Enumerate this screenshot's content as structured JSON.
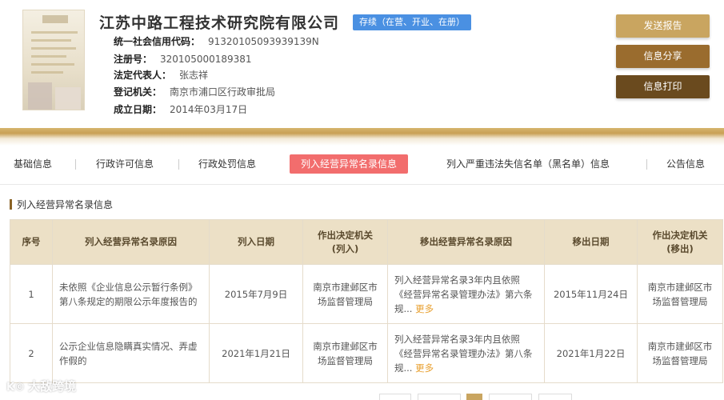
{
  "company": {
    "name": "江苏中路工程技术研究院有限公司",
    "status": "存续（在营、开业、在册）",
    "fields": [
      {
        "label": "统一社会信用代码：",
        "value": "91320105093939139N"
      },
      {
        "label": "注册号：",
        "value": "320105000189381"
      },
      {
        "label": "法定代表人：",
        "value": "张志祥"
      },
      {
        "label": "登记机关：",
        "value": "南京市浦口区行政审批局"
      },
      {
        "label": "成立日期：",
        "value": "2014年03月17日"
      }
    ]
  },
  "actions": {
    "send_report": "发送报告",
    "share": "信息分享",
    "print": "信息打印"
  },
  "tabs": [
    {
      "label": "基础信息"
    },
    {
      "label": "行政许可信息"
    },
    {
      "label": "行政处罚信息"
    },
    {
      "label": "列入经营异常名录信息"
    },
    {
      "label": "列入严重违法失信名单（黑名单）信息"
    },
    {
      "label": "公告信息"
    }
  ],
  "active_tab": "列入经营异常名录信息",
  "section": {
    "title": "列入经营异常名录信息"
  },
  "table": {
    "headers": {
      "seq": "序号",
      "reason_in": "列入经营异常名录原因",
      "date_in": "列入日期",
      "authority_in_1": "作出决定机关",
      "authority_in_2": "(列入)",
      "reason_out": "移出经营异常名录原因",
      "date_out": "移出日期",
      "authority_out_1": "作出决定机关",
      "authority_out_2": "(移出)"
    },
    "rows": [
      {
        "seq": "1",
        "reason_in": "未依照《企业信息公示暂行条例》第八条规定的期限公示年度报告的",
        "date_in": "2015年7月9日",
        "authority_in": "南京市建邺区市场监督管理局",
        "reason_out": "列入经营异常名录3年内且依照《经营异常名录管理办法》第六条规...",
        "more": "更多",
        "date_out": "2015年11月24日",
        "authority_out": "南京市建邺区市场监督管理局"
      },
      {
        "seq": "2",
        "reason_in": "公示企业信息隐瞒真实情况、弄虚作假的",
        "date_in": "2021年1月21日",
        "authority_in": "南京市建邺区市场监督管理局",
        "reason_out": "列入经营异常名录3年内且依照《经营异常名录管理办法》第八条规...",
        "more": "更多",
        "date_out": "2021年1月22日",
        "authority_out": "南京市建邺区市场监督管理局"
      }
    ]
  },
  "watermark": "大敌跨境",
  "colors": {
    "status_tag": "#4a90e2",
    "active_tab": "#f26d6d",
    "btn_send": "#c9a560",
    "btn_share": "#9a6c2e",
    "btn_print": "#6a4a1e",
    "table_header": "#ece0c6",
    "more_link": "#e8a030"
  }
}
